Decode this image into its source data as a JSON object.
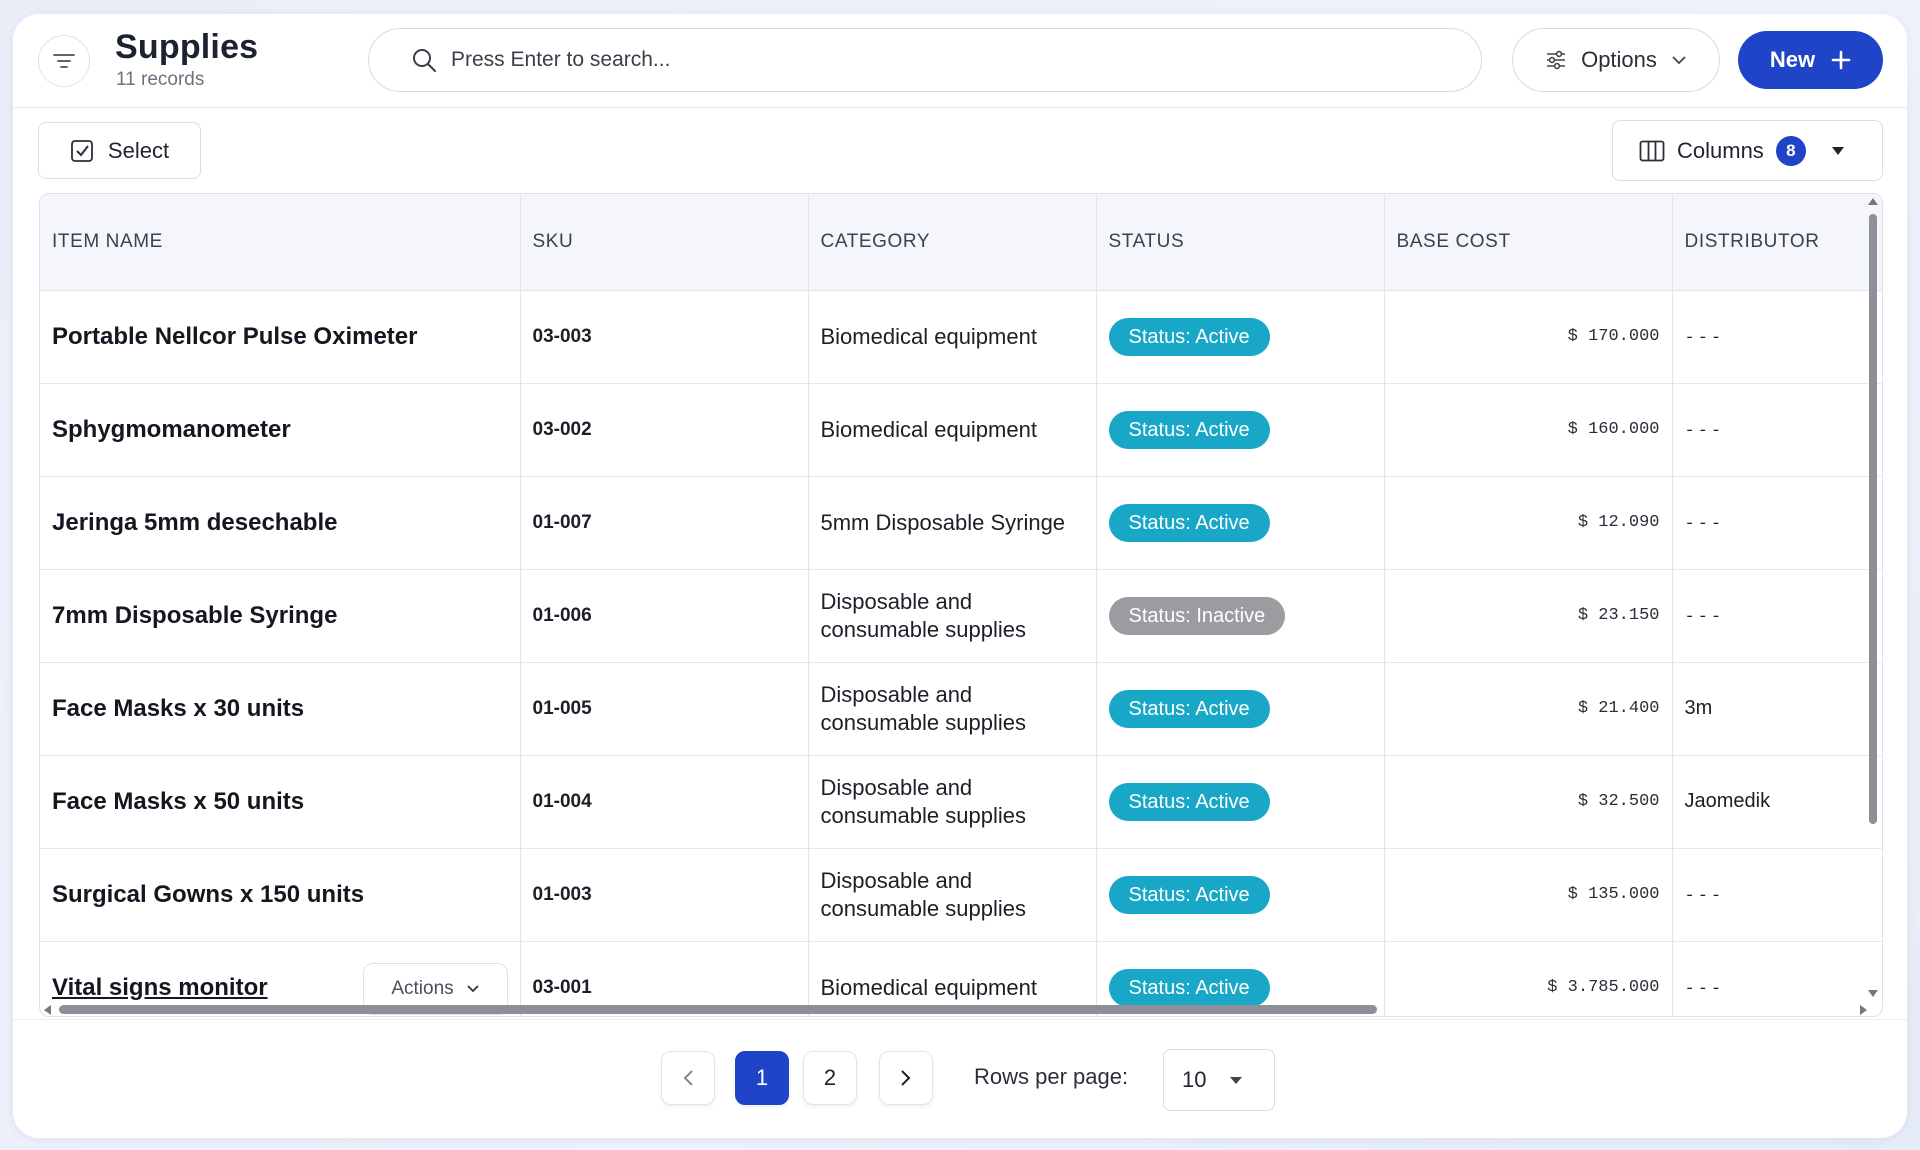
{
  "header": {
    "title": "Supplies",
    "subtitle": "11 records",
    "search_placeholder": "Press Enter to search...",
    "options_label": "Options",
    "new_label": "New"
  },
  "toolbar": {
    "select_label": "Select",
    "columns_label": "Columns",
    "columns_count": "8"
  },
  "table": {
    "columns": [
      "ITEM NAME",
      "SKU",
      "CATEGORY",
      "STATUS",
      "BASE COST",
      "DISTRIBUTOR"
    ],
    "rows": [
      {
        "name": "Portable Nellcor Pulse Oximeter",
        "sku": "03-003",
        "category": "Biomedical equipment",
        "status": "Status: Active",
        "cost": "$ 170.000",
        "distributor": "---"
      },
      {
        "name": "Sphygmomanometer",
        "sku": "03-002",
        "category": "Biomedical equipment",
        "status": "Status: Active",
        "cost": "$ 160.000",
        "distributor": "---"
      },
      {
        "name": "Jeringa 5mm desechable",
        "sku": "01-007",
        "category": "5mm Disposable Syringe",
        "status": "Status: Active",
        "cost": "$ 12.090",
        "distributor": "---"
      },
      {
        "name": "7mm Disposable Syringe",
        "sku": "01-006",
        "category": "Disposable and consumable supplies",
        "status": "Status: Inactive",
        "cost": "$ 23.150",
        "distributor": "---"
      },
      {
        "name": "Face Masks x 30 units",
        "sku": "01-005",
        "category": "Disposable and consumable supplies",
        "status": "Status: Active",
        "cost": "$ 21.400",
        "distributor": "3m"
      },
      {
        "name": "Face Masks x 50 units",
        "sku": "01-004",
        "category": "Disposable and consumable supplies",
        "status": "Status: Active",
        "cost": "$ 32.500",
        "distributor": "Jaomedik"
      },
      {
        "name": "Surgical Gowns x 150 units",
        "sku": "01-003",
        "category": "Disposable and consumable supplies",
        "status": "Status: Active",
        "cost": "$ 135.000",
        "distributor": "---"
      },
      {
        "name": "Vital signs monitor",
        "sku": "03-001",
        "category": "Biomedical equipment",
        "status": "Status: Active",
        "cost": "$ 3.785.000",
        "distributor": "---",
        "actions_label": "Actions"
      }
    ]
  },
  "pagination": {
    "pages": [
      "1",
      "2"
    ],
    "current_page": "1",
    "rows_per_page_label": "Rows per page:",
    "rows_per_page_value": "10"
  },
  "colors": {
    "primary": "#1f44c8",
    "status_active": "#18a7c6",
    "status_inactive": "#9b9ca0"
  },
  "icons": {
    "filter": "filter-lines-icon",
    "search": "search-icon",
    "options": "sliders-icon",
    "new": "plus-icon",
    "select": "checkbox-icon",
    "columns": "columns-icon",
    "prev": "chevron-left-icon",
    "next": "chevron-right-icon"
  }
}
